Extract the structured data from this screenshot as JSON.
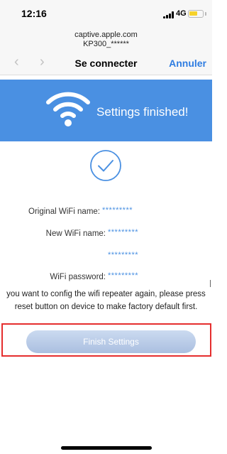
{
  "status_bar": {
    "time": "12:16",
    "network": "4G"
  },
  "browser": {
    "domain": "captive.apple.com",
    "ssid": "KP300_******",
    "title": "Se connecter",
    "cancel_label": "Annuler",
    "back_icon": "chevron-left-icon",
    "forward_icon": "chevron-right-icon"
  },
  "banner": {
    "text": "Settings finished!",
    "color": "#4a90e2",
    "icon": "wifi-icon"
  },
  "success_icon": "check-circle-icon",
  "info": {
    "original_wifi_label": "Original WiFi name:",
    "original_wifi_value": "*********",
    "new_wifi_label": "New WiFi name:",
    "new_wifi_value": "*********",
    "new_wifi_value_2": "*********",
    "password_label": "WiFi password:",
    "password_value": "*********"
  },
  "note": {
    "line1": "you want to config the wifi repeater again, please press",
    "line2": "reset button on device to make factory default first."
  },
  "finish_button_label": "Finish Settings",
  "colors": {
    "accent": "#4a90e2",
    "ios_link": "#2f7de1",
    "highlight": "#e52e2e"
  }
}
